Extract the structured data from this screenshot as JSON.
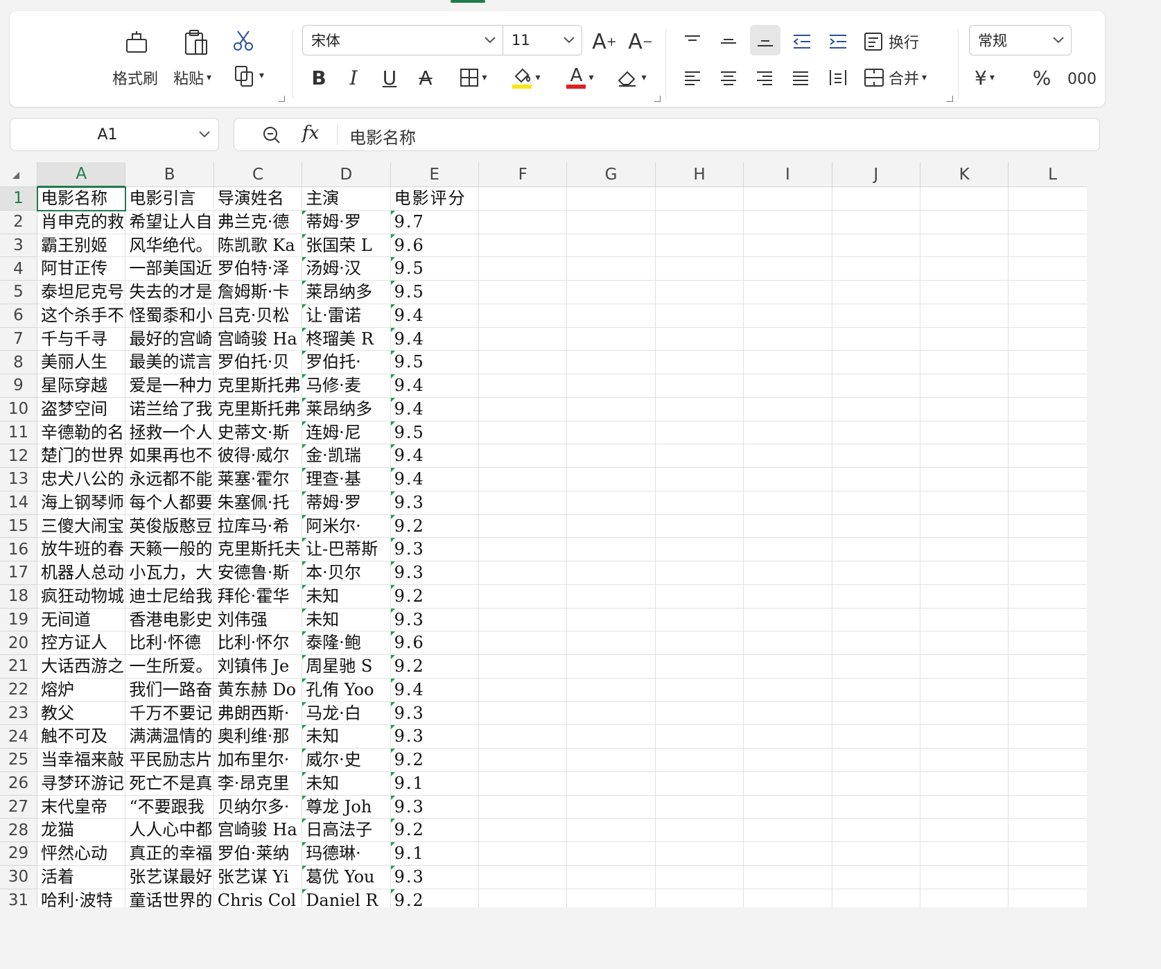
{
  "ribbon": {
    "format_painter": "格式刷",
    "paste": "粘贴",
    "font_name": "宋体",
    "font_size": "11",
    "wrap_text": "换行",
    "merge": "合并",
    "number_format": "常规",
    "currency_symbol": "¥",
    "percent_symbol": "%",
    "thousands_symbol": "000",
    "bold": "B",
    "italic": "I",
    "underline": "U",
    "strikethrough": "A",
    "font_color_letter": "A",
    "fill_color": "#f5e614",
    "font_color": "#e02020",
    "accent_color": "#1e7b4c"
  },
  "formula_bar": {
    "name_box": "A1",
    "fx": "fx",
    "content": "电影名称"
  },
  "sheet": {
    "columns": [
      "A",
      "B",
      "C",
      "D",
      "E",
      "F",
      "G",
      "H",
      "I",
      "J",
      "K",
      "L"
    ],
    "rows": [
      {
        "n": "1",
        "a": "电影名称",
        "b": "电影引言",
        "c": "导演姓名",
        "d": "主演",
        "e": "电影评分"
      },
      {
        "n": "2",
        "a": "肖申克的救",
        "b": "希望让人自",
        "c": "弗兰克·德",
        "d": " 蒂姆·罗",
        "e": "9.7"
      },
      {
        "n": "3",
        "a": "霸王别姬",
        "b": "风华绝代。",
        "c": "陈凯歌 Ka",
        "d": " 张国荣 L",
        "e": "9.6"
      },
      {
        "n": "4",
        "a": "阿甘正传",
        "b": "一部美国近",
        "c": "罗伯特·泽",
        "d": " 汤姆·汉",
        "e": "9.5"
      },
      {
        "n": "5",
        "a": "泰坦尼克号",
        "b": "失去的才是",
        "c": "詹姆斯·卡",
        "d": " 莱昂纳多",
        "e": "9.5"
      },
      {
        "n": "6",
        "a": "这个杀手不",
        "b": "怪蜀黍和小",
        "c": "吕克·贝松",
        "d": " 让·雷诺",
        "e": "9.4"
      },
      {
        "n": "7",
        "a": "千与千寻",
        "b": "最好的宫崎",
        "c": "宫崎骏 Ha",
        "d": " 柊瑠美 R",
        "e": "9.4"
      },
      {
        "n": "8",
        "a": "美丽人生",
        "b": "最美的谎言",
        "c": "罗伯托·贝",
        "d": " 罗伯托·",
        "e": "9.5"
      },
      {
        "n": "9",
        "a": "星际穿越",
        "b": "爱是一种力",
        "c": "克里斯托弗",
        "d": " 马修·麦",
        "e": "9.4"
      },
      {
        "n": "10",
        "a": "盗梦空间",
        "b": "诺兰给了我",
        "c": "克里斯托弗",
        "d": " 莱昂纳多",
        "e": "9.4"
      },
      {
        "n": "11",
        "a": "辛德勒的名",
        "b": "拯救一个人",
        "c": "史蒂文·斯",
        "d": " 连姆·尼",
        "e": "9.5"
      },
      {
        "n": "12",
        "a": "楚门的世界",
        "b": "如果再也不",
        "c": "彼得·威尔",
        "d": " 金·凯瑞",
        "e": "9.4"
      },
      {
        "n": "13",
        "a": "忠犬八公的",
        "b": "永远都不能",
        "c": "莱塞·霍尔",
        "d": " 理查·基",
        "e": "9.4"
      },
      {
        "n": "14",
        "a": "海上钢琴师",
        "b": "每个人都要",
        "c": "朱塞佩·托",
        "d": " 蒂姆·罗",
        "e": "9.3"
      },
      {
        "n": "15",
        "a": "三傻大闹宝",
        "b": "英俊版憨豆",
        "c": "拉库马·希",
        "d": " 阿米尔·",
        "e": "9.2"
      },
      {
        "n": "16",
        "a": "放牛班的春",
        "b": "天籁一般的",
        "c": "克里斯托夫",
        "d": " 让-巴蒂斯",
        "e": "9.3"
      },
      {
        "n": "17",
        "a": "机器人总动",
        "b": "小瓦力，大",
        "c": "安德鲁·斯",
        "d": " 本·贝尔",
        "e": "9.3"
      },
      {
        "n": "18",
        "a": "疯狂动物城",
        "b": "迪士尼给我",
        "c": "拜伦·霍华",
        "d": "未知",
        "e": "9.2"
      },
      {
        "n": "19",
        "a": "无间道",
        "b": "香港电影史",
        "c": "刘伟强",
        "d": " 未知",
        "e": "9.3"
      },
      {
        "n": "20",
        "a": "控方证人",
        "b": "比利·怀德",
        "c": "比利·怀尔",
        "d": " 泰隆·鲍",
        "e": "9.6"
      },
      {
        "n": "21",
        "a": "大话西游之",
        "b": "一生所爱。",
        "c": "刘镇伟 Je",
        "d": " 周星驰 S",
        "e": "9.2"
      },
      {
        "n": "22",
        "a": "熔炉",
        "b": "我们一路奋",
        "c": "黄东赫 Do",
        "d": " 孔侑 Yoo",
        "e": "9.4"
      },
      {
        "n": "23",
        "a": "教父",
        "b": "千万不要记",
        "c": "弗朗西斯·",
        "d": " 马龙·白",
        "e": "9.3"
      },
      {
        "n": "24",
        "a": "触不可及",
        "b": "满满温情的",
        "c": "奥利维·那",
        "d": "未知",
        "e": "9.3"
      },
      {
        "n": "25",
        "a": "当幸福来敲",
        "b": "平民励志片",
        "c": "加布里尔·",
        "d": " 威尔·史",
        "e": "9.2"
      },
      {
        "n": "26",
        "a": "寻梦环游记",
        "b": "死亡不是真",
        "c": "李·昂克里",
        "d": "未知",
        "e": "9.1"
      },
      {
        "n": "27",
        "a": "末代皇帝",
        "b": "“不要跟我",
        "c": "贝纳尔多·",
        "d": " 尊龙 Joh",
        "e": "9.3"
      },
      {
        "n": "28",
        "a": "龙猫",
        "b": "人人心中都",
        "c": "宫崎骏 Ha",
        "d": " 日高法子",
        "e": "9.2"
      },
      {
        "n": "29",
        "a": "怦然心动",
        "b": "真正的幸福",
        "c": "罗伯·莱纳",
        "d": " 玛德琳·",
        "e": "9.1"
      },
      {
        "n": "30",
        "a": "活着",
        "b": "张艺谋最好",
        "c": "张艺谋 Yi",
        "d": " 葛优 You",
        "e": "9.3"
      },
      {
        "n": "31",
        "a": "哈利·波特",
        "b": "童话世界的",
        "c": "Chris Col",
        "d": " Daniel R",
        "e": "9.2"
      }
    ]
  }
}
